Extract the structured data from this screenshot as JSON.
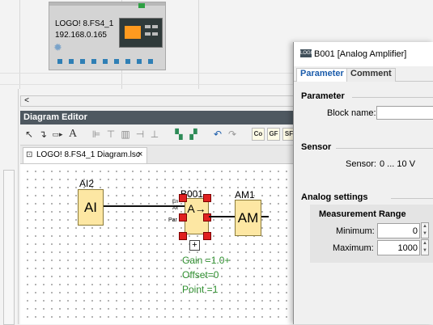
{
  "network_view": {
    "device_name": "LOGO! 8.FS4_1",
    "device_ip": "192.168.0.165"
  },
  "diagram_editor": {
    "title": "Diagram Editor",
    "tab_label": "LOGO! 8.FS4_1 Diagram.lsc",
    "tab_close": "×",
    "toolbar_text_tool": "A",
    "toolbar_co": "Co",
    "toolbar_gf": "GF",
    "toolbar_sf": "SF",
    "scroll_left": "<"
  },
  "diagram": {
    "input_block": {
      "name": "AI2",
      "symbol": "AI"
    },
    "function_block": {
      "name": "B001",
      "symbol": "A→",
      "pin_en": "En",
      "pin_ax": "Ax",
      "pin_par": "Par",
      "expand": "+"
    },
    "output_block": {
      "name": "AM1",
      "symbol": "AM"
    },
    "params": [
      "Gain =1.0+",
      "Offset=0",
      "Point =1"
    ]
  },
  "dialog": {
    "logo": "LOGO",
    "title": "B001 [Analog Amplifier]",
    "tabs": [
      "Parameter",
      "Comment"
    ],
    "parameter_section": "Parameter",
    "block_name_label": "Block name:",
    "block_name_value": "",
    "sensor_section": "Sensor",
    "sensor_label": "Sensor:",
    "sensor_value": "0 ... 10 V",
    "analog_section": "Analog settings",
    "range_title": "Measurement Range",
    "minimum_label": "Minimum:",
    "minimum_value": "0",
    "maximum_label": "Maximum:",
    "maximum_value": "1000"
  },
  "colors": {
    "block_fill": "#fde7a3",
    "selection_handle": "#e02020",
    "param_text": "#2f8f2f",
    "header_bg": "#4e5860",
    "tab_active_text": "#1b5cab"
  }
}
